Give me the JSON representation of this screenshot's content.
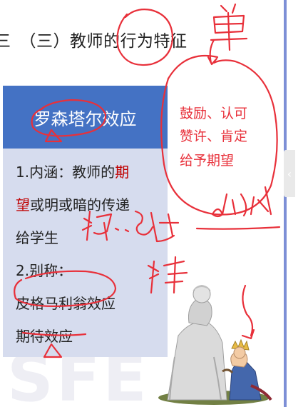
{
  "slide": {
    "heading": "三　（三）教师的行为特征",
    "card": {
      "title": "罗森塔尔效应",
      "line1_part1": "1.内涵：教师的",
      "line1_highlight_a": "期",
      "line1_highlight_b": "望",
      "line2_rest": "或明或暗的传递",
      "line3": "给学生",
      "line4": "2.别称：",
      "line5": "皮格马利翁效应",
      "line6": "期待效应"
    },
    "highlight_color": "#c00000",
    "accent_color": "#4472c4"
  },
  "annotations": {
    "note_1": "鼓励、认可",
    "note_2": "赞许、肯定",
    "note_3": "给予期望",
    "ink_color": "#e8303a"
  },
  "side_tab_glyph": "‹",
  "watermark": "SFE"
}
